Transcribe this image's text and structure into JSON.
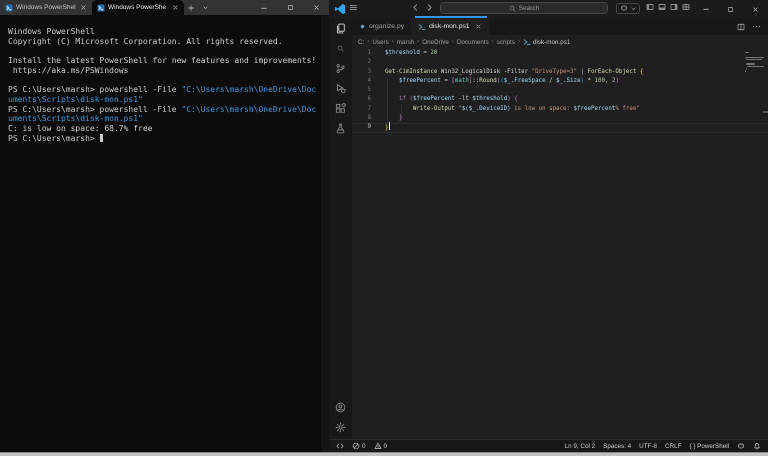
{
  "colors": {
    "fg": "#cccccc",
    "blue": "#3A96DD",
    "code_fg": "#d4d4d4",
    "var": "#9CDCFE",
    "num": "#B5CEA8",
    "fn": "#DCDCAA",
    "str": "#CE9178",
    "kw": "#C586C0",
    "type": "#4EC9B0",
    "b1": "#FFD700",
    "b2": "#DA70D6",
    "b3": "#179FFF",
    "accent": "#3794ff"
  },
  "terminal": {
    "tabs": [
      {
        "label": "Windows PowerShel",
        "active": false
      },
      {
        "label": "Windows PowerShe",
        "active": true
      }
    ],
    "lines": [
      {
        "segments": [
          {
            "t": "Windows PowerShell",
            "c": "fg"
          }
        ]
      },
      {
        "segments": [
          {
            "t": "Copyright (C) Microsoft Corporation. All rights reserved.",
            "c": "fg"
          }
        ]
      },
      {
        "segments": []
      },
      {
        "segments": [
          {
            "t": "Install the latest PowerShell for new features and improvements!",
            "c": "fg"
          }
        ]
      },
      {
        "segments": [
          {
            "t": " https://aka.ms/PSWindows",
            "c": "fg"
          }
        ]
      },
      {
        "segments": []
      },
      {
        "segments": [
          {
            "t": "PS C:\\Users\\marsh> powershell -File ",
            "c": "fg"
          },
          {
            "t": "\"C:\\Users\\marsh\\OneDrive\\Doc",
            "c": "blue"
          }
        ]
      },
      {
        "segments": [
          {
            "t": "uments\\Scripts\\disk-mon.ps1\"",
            "c": "blue"
          }
        ]
      },
      {
        "segments": [
          {
            "t": "PS C:\\Users\\marsh> powershell -File ",
            "c": "fg"
          },
          {
            "t": "\"C:\\Users\\marsh\\OneDrive\\Doc",
            "c": "blue"
          }
        ]
      },
      {
        "segments": [
          {
            "t": "uments\\Scripts\\disk-mon.ps1\"",
            "c": "blue"
          }
        ]
      },
      {
        "segments": [
          {
            "t": "C: is low on space: 68.7% free",
            "c": "fg"
          }
        ]
      },
      {
        "segments": [
          {
            "t": "PS C:\\Users\\marsh> ",
            "c": "fg"
          }
        ],
        "cursor": true
      }
    ]
  },
  "vscode": {
    "title_bar": {
      "search_placeholder": "Search"
    },
    "activity_bar": {
      "top": [
        {
          "name": "explorer",
          "icon": "files",
          "active": true
        },
        {
          "name": "search",
          "icon": "search",
          "active": false
        },
        {
          "name": "source-control",
          "icon": "scm",
          "active": false
        },
        {
          "name": "run-debug",
          "icon": "debug",
          "active": false
        },
        {
          "name": "extensions",
          "icon": "extensions",
          "active": false
        },
        {
          "name": "testing",
          "icon": "beaker",
          "active": false
        }
      ],
      "bottom": [
        {
          "name": "account",
          "icon": "account",
          "active": false
        },
        {
          "name": "settings",
          "icon": "gear",
          "active": false
        }
      ]
    },
    "tabs": [
      {
        "label": "organize.py",
        "icon": "pyfile",
        "active": false,
        "closable": false
      },
      {
        "label": "disk-mon.ps1",
        "icon": "psfile",
        "active": true,
        "closable": true
      }
    ],
    "breadcrumbs": [
      "C:",
      "Users",
      "marsh",
      "OneDrive",
      "Documents",
      "scripts"
    ],
    "breadcrumb_file": "disk-mon.ps1",
    "editor": {
      "lines": [
        {
          "num": "1",
          "segments": [
            {
              "t": "$threshold",
              "c": "var"
            },
            {
              "t": " = ",
              "c": "code_fg"
            },
            {
              "t": "20",
              "c": "num"
            }
          ]
        },
        {
          "num": "2",
          "segments": []
        },
        {
          "num": "3",
          "segments": [
            {
              "t": "Get-CimInstance",
              "c": "fn"
            },
            {
              "t": " Win32_LogicalDisk ",
              "c": "code_fg"
            },
            {
              "t": "-Filter ",
              "c": "code_fg"
            },
            {
              "t": "\"DriveType=3\"",
              "c": "str"
            },
            {
              "t": " | ",
              "c": "code_fg"
            },
            {
              "t": "ForEach-Object ",
              "c": "fn"
            },
            {
              "t": "{",
              "c": "b1"
            }
          ]
        },
        {
          "num": "4",
          "segments": [
            {
              "t": "    ",
              "c": "code_fg"
            },
            {
              "t": "$freePercent",
              "c": "var"
            },
            {
              "t": " = ",
              "c": "code_fg"
            },
            {
              "t": "[",
              "c": "b2"
            },
            {
              "t": "math",
              "c": "type"
            },
            {
              "t": "]",
              "c": "b2"
            },
            {
              "t": "::",
              "c": "code_fg"
            },
            {
              "t": "Round",
              "c": "fn"
            },
            {
              "t": "(",
              "c": "b2"
            },
            {
              "t": "(",
              "c": "b3"
            },
            {
              "t": "$_",
              "c": "var"
            },
            {
              "t": ".FreeSpace",
              "c": "var"
            },
            {
              "t": " / ",
              "c": "code_fg"
            },
            {
              "t": "$_",
              "c": "var"
            },
            {
              "t": ".Size",
              "c": "var"
            },
            {
              "t": ")",
              "c": "b3"
            },
            {
              "t": " * ",
              "c": "code_fg"
            },
            {
              "t": "100",
              "c": "num"
            },
            {
              "t": ", ",
              "c": "code_fg"
            },
            {
              "t": "2",
              "c": "num"
            },
            {
              "t": ")",
              "c": "b2"
            }
          ]
        },
        {
          "num": "5",
          "segments": []
        },
        {
          "num": "6",
          "segments": [
            {
              "t": "    ",
              "c": "code_fg"
            },
            {
              "t": "if",
              "c": "kw"
            },
            {
              "t": " ",
              "c": "code_fg"
            },
            {
              "t": "(",
              "c": "b2"
            },
            {
              "t": "$freePercent",
              "c": "var"
            },
            {
              "t": " -lt ",
              "c": "code_fg"
            },
            {
              "t": "$threshold",
              "c": "var"
            },
            {
              "t": ")",
              "c": "b2"
            },
            {
              "t": " ",
              "c": "code_fg"
            },
            {
              "t": "{",
              "c": "b2"
            }
          ]
        },
        {
          "num": "7",
          "segments": [
            {
              "t": "        ",
              "c": "code_fg"
            },
            {
              "t": "Write-Output",
              "c": "fn"
            },
            {
              "t": " ",
              "c": "code_fg"
            },
            {
              "t": "\"",
              "c": "str"
            },
            {
              "t": "$($_.DeviceID)",
              "c": "var"
            },
            {
              "t": " is low on space: ",
              "c": "str"
            },
            {
              "t": "$freePercent",
              "c": "var"
            },
            {
              "t": "% free\"",
              "c": "str"
            }
          ]
        },
        {
          "num": "8",
          "segments": [
            {
              "t": "    ",
              "c": "code_fg"
            },
            {
              "t": "}",
              "c": "b2"
            }
          ]
        },
        {
          "num": "9",
          "segments": [
            {
              "t": "}",
              "c": "b1"
            }
          ],
          "cursor": true,
          "current": true
        }
      ]
    },
    "status_bar": {
      "left": [
        {
          "icon": "remote",
          "label": ""
        },
        {
          "icon": "error",
          "label": "0"
        },
        {
          "icon": "warning",
          "label": "0"
        }
      ],
      "right": [
        {
          "label": "Ln 9, Col 2"
        },
        {
          "label": "Spaces: 4"
        },
        {
          "label": "UTF-8"
        },
        {
          "label": "CRLF"
        },
        {
          "label": "{ } PowerShell"
        },
        {
          "icon": "copilot",
          "label": ""
        },
        {
          "icon": "bell",
          "label": ""
        }
      ]
    }
  }
}
